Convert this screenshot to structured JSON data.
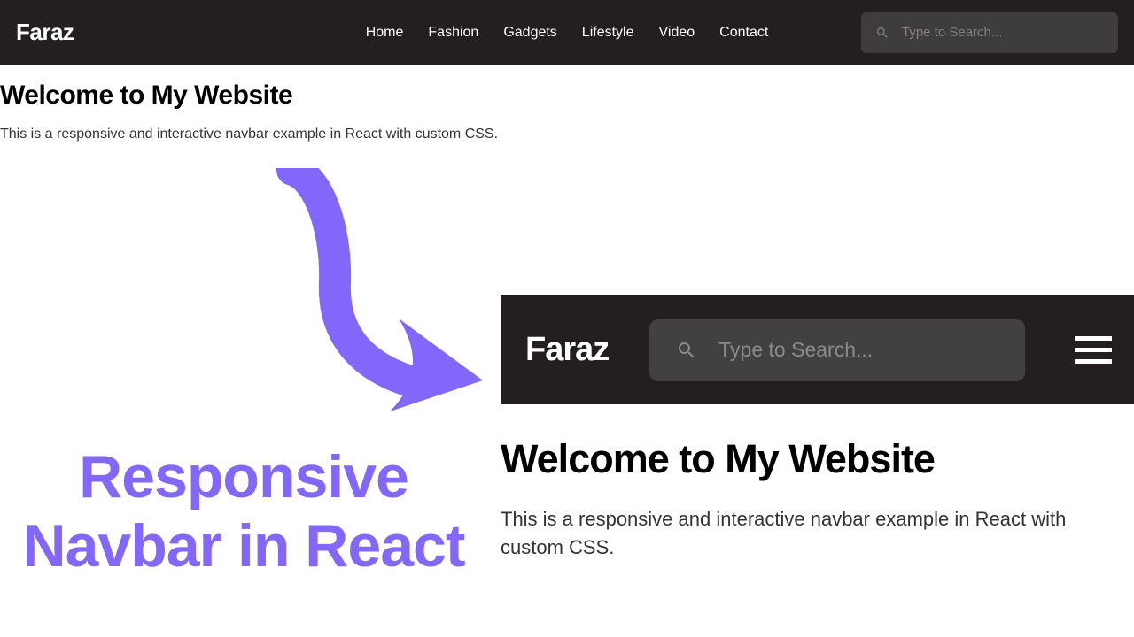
{
  "brand": "Faraz",
  "nav": {
    "items": [
      "Home",
      "Fashion",
      "Gadgets",
      "Lifestyle",
      "Video",
      "Contact"
    ]
  },
  "search": {
    "placeholder": "Type to Search..."
  },
  "intro": {
    "heading": "Welcome to My Website",
    "paragraph": "This is a responsive and interactive navbar example in React with custom CSS."
  },
  "promo": {
    "line1": "Responsive",
    "line2": "Navbar in React"
  },
  "mobile": {
    "brand": "Faraz",
    "search_placeholder": "Type to Search...",
    "heading": "Welcome to My Website",
    "paragraph": "This is a responsive and interactive navbar example in React with custom CSS."
  },
  "colors": {
    "navbar_bg": "#231f20",
    "accent": "#8367fa"
  }
}
